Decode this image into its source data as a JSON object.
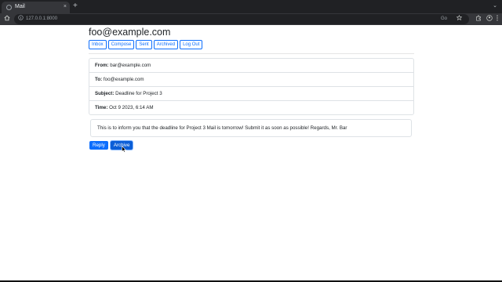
{
  "browser": {
    "tab_title": "Mail",
    "tab_close": "×",
    "new_tab": "+",
    "tab_menu": "⌄",
    "url": "127.0.0.1:8000",
    "zoom": "Go",
    "icons": {
      "home": "home-icon",
      "info": "info-icon",
      "star": "star-icon",
      "extensions": "puzzle-icon",
      "profile": "profile-icon",
      "menu": "kebab-menu-icon"
    }
  },
  "account": {
    "email": "foo@example.com"
  },
  "nav": {
    "inbox": "Inbox",
    "compose": "Compose",
    "sent": "Sent",
    "archived": "Archived",
    "logout": "Log Out"
  },
  "email": {
    "from_label": "From:",
    "from": "bar@example.com",
    "to_label": "To:",
    "to": "foo@example.com",
    "subject_label": "Subject:",
    "subject": "Deadline for Project 3",
    "time_label": "Time:",
    "time": "Oct 9 2023, 6:14 AM",
    "body": "This is to inform you that the deadline for Project 3 Mail is tomorrow! Submit it as soon as possible! Regards, Mr. Bar"
  },
  "actions": {
    "reply": "Reply",
    "archive": "Archive"
  },
  "colors": {
    "primary": "#0d6efd",
    "primary_active": "#0b5ed7",
    "chrome_dark": "#202124",
    "chrome_toolbar": "#35363a"
  }
}
